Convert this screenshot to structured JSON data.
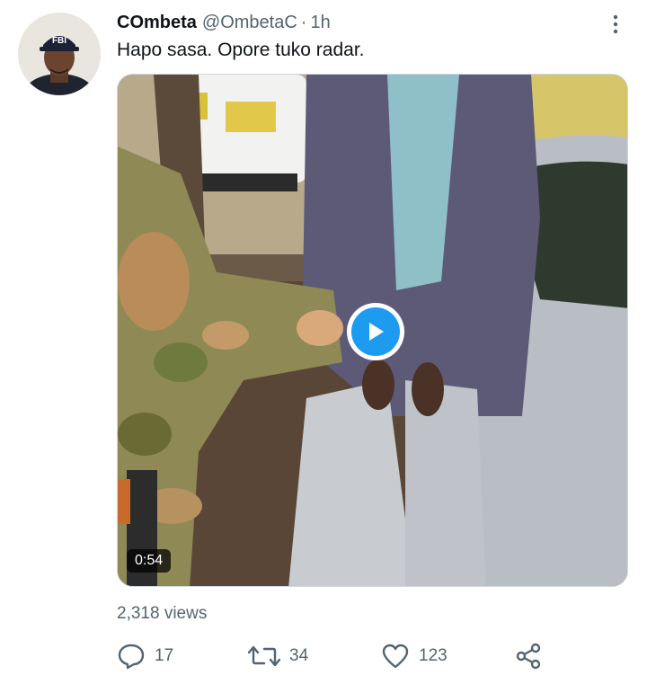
{
  "tweet": {
    "display_name": "COmbeta",
    "handle": "@OmbetaC",
    "separator": "·",
    "time": "1h",
    "text": "Hapo sasa. Opore tuko radar.",
    "avatar_cap_text": "FBI",
    "more_icon": "more-vertical-icon"
  },
  "media": {
    "duration": "0:54",
    "play_icon": "play-icon",
    "accent_color": "#1d9bf0"
  },
  "views": "2,318 views",
  "actions": {
    "reply": {
      "icon": "reply-icon",
      "count": "17"
    },
    "retweet": {
      "icon": "retweet-icon",
      "count": "34"
    },
    "like": {
      "icon": "heart-icon",
      "count": "123"
    },
    "share": {
      "icon": "share-icon"
    }
  }
}
